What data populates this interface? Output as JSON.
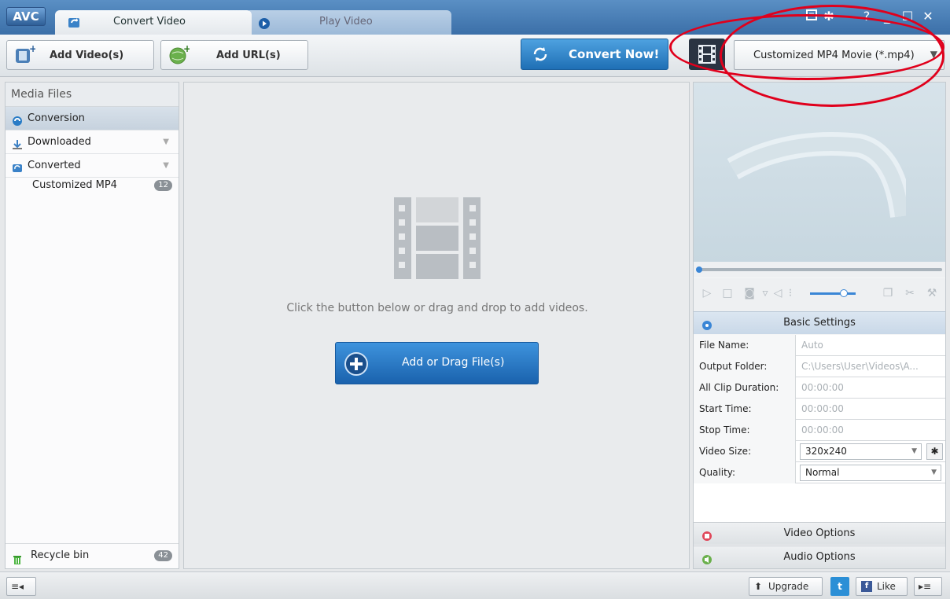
{
  "titlebar": {
    "logo": "AVC",
    "tabs": [
      {
        "label": "Convert Video",
        "icon": "convert-icon",
        "active": true
      },
      {
        "label": "Play Video",
        "icon": "play-icon",
        "active": false
      }
    ],
    "controls": [
      "settings-list-icon",
      "gear-icon",
      "help-icon",
      "minimize-icon",
      "maximize-icon",
      "close-icon"
    ]
  },
  "toolbar": {
    "add_videos": "Add Video(s)",
    "add_url": "Add URL(s)",
    "convert_now": "Convert Now!",
    "profile": "Customized MP4 Movie (*.mp4)"
  },
  "sidebar": {
    "header": "Media Files",
    "items": [
      {
        "label": "Conversion",
        "selected": true
      },
      {
        "label": "Downloaded",
        "selected": false
      },
      {
        "label": "Converted",
        "selected": false
      }
    ],
    "sub_item": {
      "label": "Customized MP4",
      "count": "12"
    },
    "recycle": {
      "label": "Recycle bin",
      "count": "42"
    }
  },
  "center": {
    "hint": "Click the button below or drag and drop to add videos.",
    "add_button": "Add or Drag File(s)"
  },
  "settings": {
    "title": "Basic Settings",
    "rows": [
      {
        "key": "File Name:",
        "value": "Auto"
      },
      {
        "key": "Output Folder:",
        "value": "C:\\Users\\User\\Videos\\A..."
      },
      {
        "key": "All Clip Duration:",
        "value": "00:00:00"
      },
      {
        "key": "Start Time:",
        "value": "00:00:00"
      },
      {
        "key": "Stop Time:",
        "value": "00:00:00"
      },
      {
        "key": "Video Size:",
        "value": "320x240"
      },
      {
        "key": "Quality:",
        "value": "Normal"
      }
    ],
    "video_options": "Video Options",
    "audio_options": "Audio Options"
  },
  "statusbar": {
    "upgrade": "Upgrade",
    "like": "Like"
  },
  "colors": {
    "accent_blue": "#1f6fb5",
    "annotation_red": "#e0001c"
  }
}
